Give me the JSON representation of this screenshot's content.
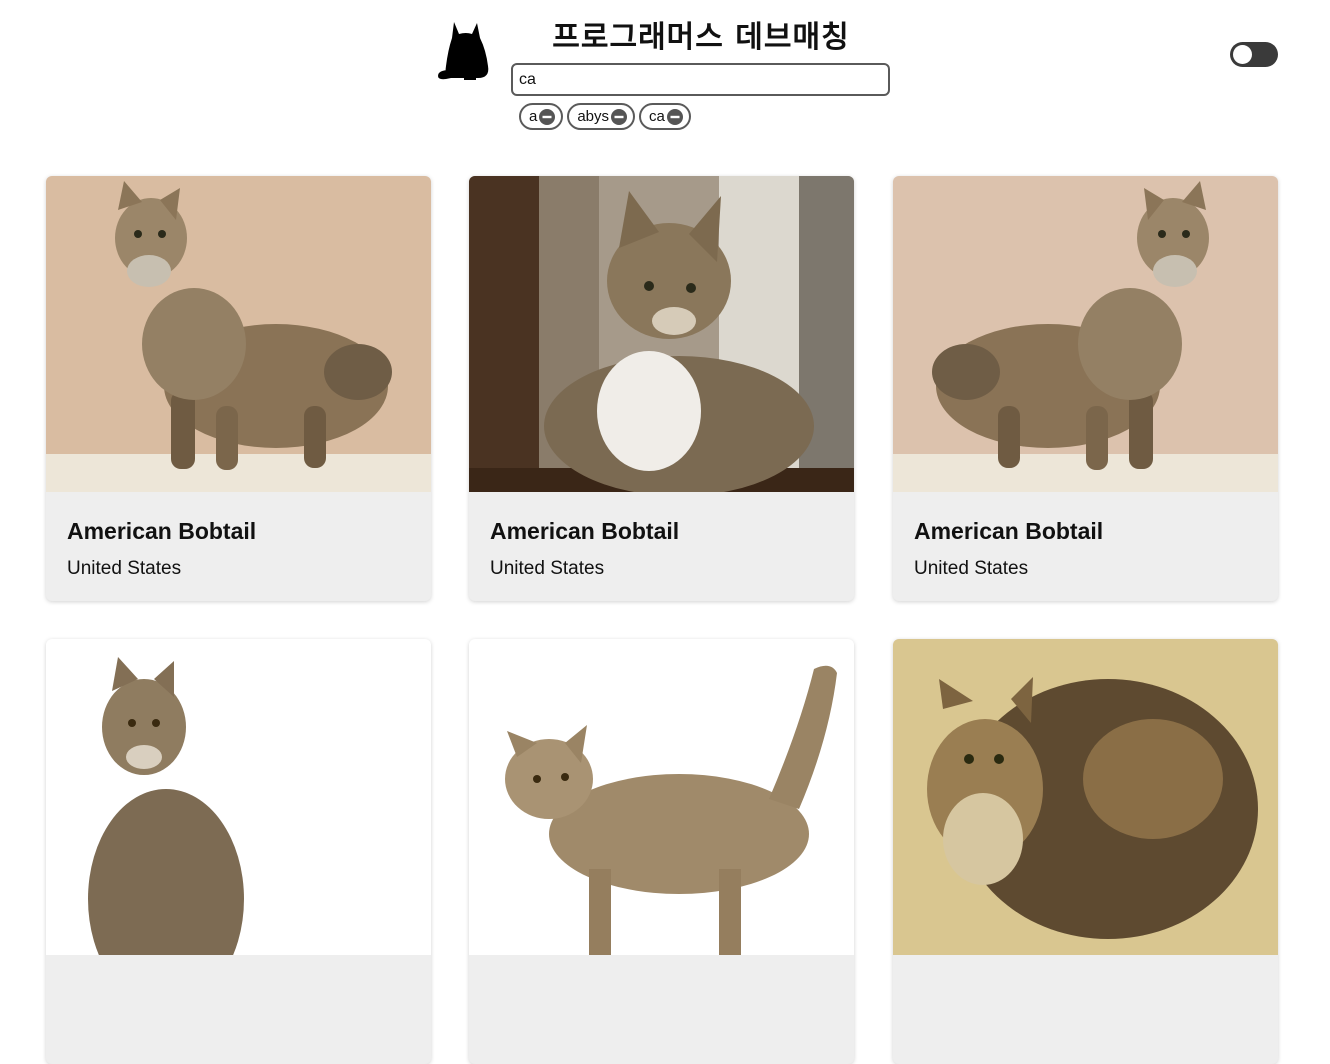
{
  "header": {
    "title": "프로그래머스 데브매칭",
    "logo_icon": "black-cat-icon",
    "theme_toggle": {
      "state": "dark",
      "icon": "toggle-switch-icon"
    }
  },
  "search": {
    "value": "ca",
    "placeholder": ""
  },
  "keywords": [
    {
      "label": "a",
      "remove_icon": "minus-circle-icon"
    },
    {
      "label": "abys",
      "remove_icon": "minus-circle-icon"
    },
    {
      "label": "ca",
      "remove_icon": "minus-circle-icon"
    }
  ],
  "cards": [
    {
      "name": "American Bobtail",
      "origin": "United States",
      "image": "tabby-cat-bobtail-standing-photo"
    },
    {
      "name": "American Bobtail",
      "origin": "United States",
      "image": "tabby-cat-white-chest-lying-photo"
    },
    {
      "name": "American Bobtail",
      "origin": "United States",
      "image": "tabby-cat-bobtail-standing-mirrored-photo"
    },
    {
      "name": "",
      "origin": "",
      "image": "long-haired-tabby-sitting-photo"
    },
    {
      "name": "",
      "origin": "",
      "image": "spotted-tabby-walking-photo"
    },
    {
      "name": "",
      "origin": "",
      "image": "fluffy-tabby-bobtail-photo"
    }
  ],
  "colors": {
    "background": "#ffffff",
    "card": "#eeeeee",
    "border": "#5a5a5a",
    "toggle": "#3a3a3a"
  }
}
